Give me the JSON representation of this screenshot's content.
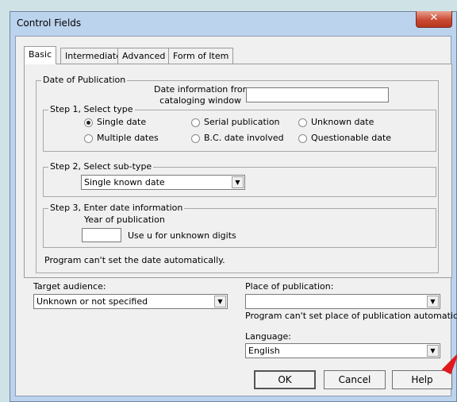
{
  "window": {
    "title": "Control Fields",
    "close_glyph": "✕"
  },
  "tabs": [
    {
      "label": "Basic"
    },
    {
      "label": "Intermediate"
    },
    {
      "label": "Advanced"
    },
    {
      "label": "Form of Item"
    }
  ],
  "date_of_publication": {
    "legend": "Date of Publication",
    "info_label_line1": "Date information from",
    "info_label_line2": "cataloging window",
    "info_value": "",
    "step1": {
      "legend": "Step 1, Select type",
      "options": [
        {
          "label": "Single date",
          "checked": true
        },
        {
          "label": "Serial publication",
          "checked": false
        },
        {
          "label": "Unknown date",
          "checked": false
        },
        {
          "label": "Multiple dates",
          "checked": false
        },
        {
          "label": "B.C. date involved",
          "checked": false
        },
        {
          "label": "Questionable date",
          "checked": false
        }
      ]
    },
    "step2": {
      "legend": "Step 2, Select sub-type",
      "selected": "Single known date"
    },
    "step3": {
      "legend": "Step 3, Enter date information",
      "year_label": "Year of publication",
      "year_value": "",
      "hint": "Use u for unknown digits"
    },
    "status": "Program can't set the date automatically."
  },
  "target_audience": {
    "label": "Target audience:",
    "selected": "Unknown or not specified"
  },
  "place_of_publication": {
    "label": "Place of publication:",
    "selected": "",
    "status": "Program can't set place of publication automatically."
  },
  "language": {
    "label": "Language:",
    "selected": "English"
  },
  "buttons": {
    "ok": "OK",
    "cancel": "Cancel",
    "help": "Help"
  },
  "icons": {
    "dropdown": "▼"
  },
  "colors": {
    "annotation_arrow": "#e0191f",
    "close_button": "#c94a33"
  }
}
